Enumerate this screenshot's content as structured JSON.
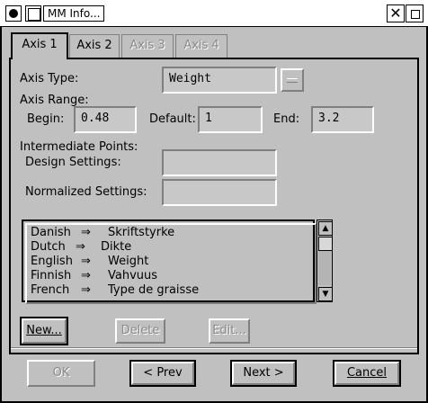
{
  "window": {
    "title": "MM Info..."
  },
  "tabs": [
    {
      "label": "Axis 1",
      "state": "active"
    },
    {
      "label": "Axis 2",
      "state": "enabled"
    },
    {
      "label": "Axis 3",
      "state": "disabled"
    },
    {
      "label": "Axis 4",
      "state": "disabled"
    }
  ],
  "axis": {
    "type_label": "Axis Type:",
    "type_value": "Weight",
    "range_label": "Axis Range:",
    "begin_label": "Begin:",
    "begin_value": "0.48",
    "default_label": "Default:",
    "default_value": "1",
    "end_label": "End:",
    "end_value": "3.2"
  },
  "intermediate": {
    "label": "Intermediate Points:",
    "design_label": "Design Settings:",
    "design_value": "",
    "normalized_label": "Normalized Settings:",
    "normalized_value": ""
  },
  "names_list": [
    {
      "language": "Danish",
      "arrow": "⇒",
      "name": "Skriftstyrke"
    },
    {
      "language": "Dutch",
      "arrow": "⇒",
      "name": "Dikte"
    },
    {
      "language": "English",
      "arrow": "⇒",
      "name": "Weight"
    },
    {
      "language": "Finnish",
      "arrow": "⇒",
      "name": "Vahvuus"
    },
    {
      "language": "French",
      "arrow": "⇒",
      "name": "Type de graisse"
    }
  ],
  "list_buttons": {
    "new_label": "New...",
    "delete_label": "Delete",
    "edit_label": "Edit..."
  },
  "footer": {
    "ok_label": "OK",
    "prev_label": "< Prev",
    "next_label": "Next >",
    "cancel_label": "Cancel"
  }
}
